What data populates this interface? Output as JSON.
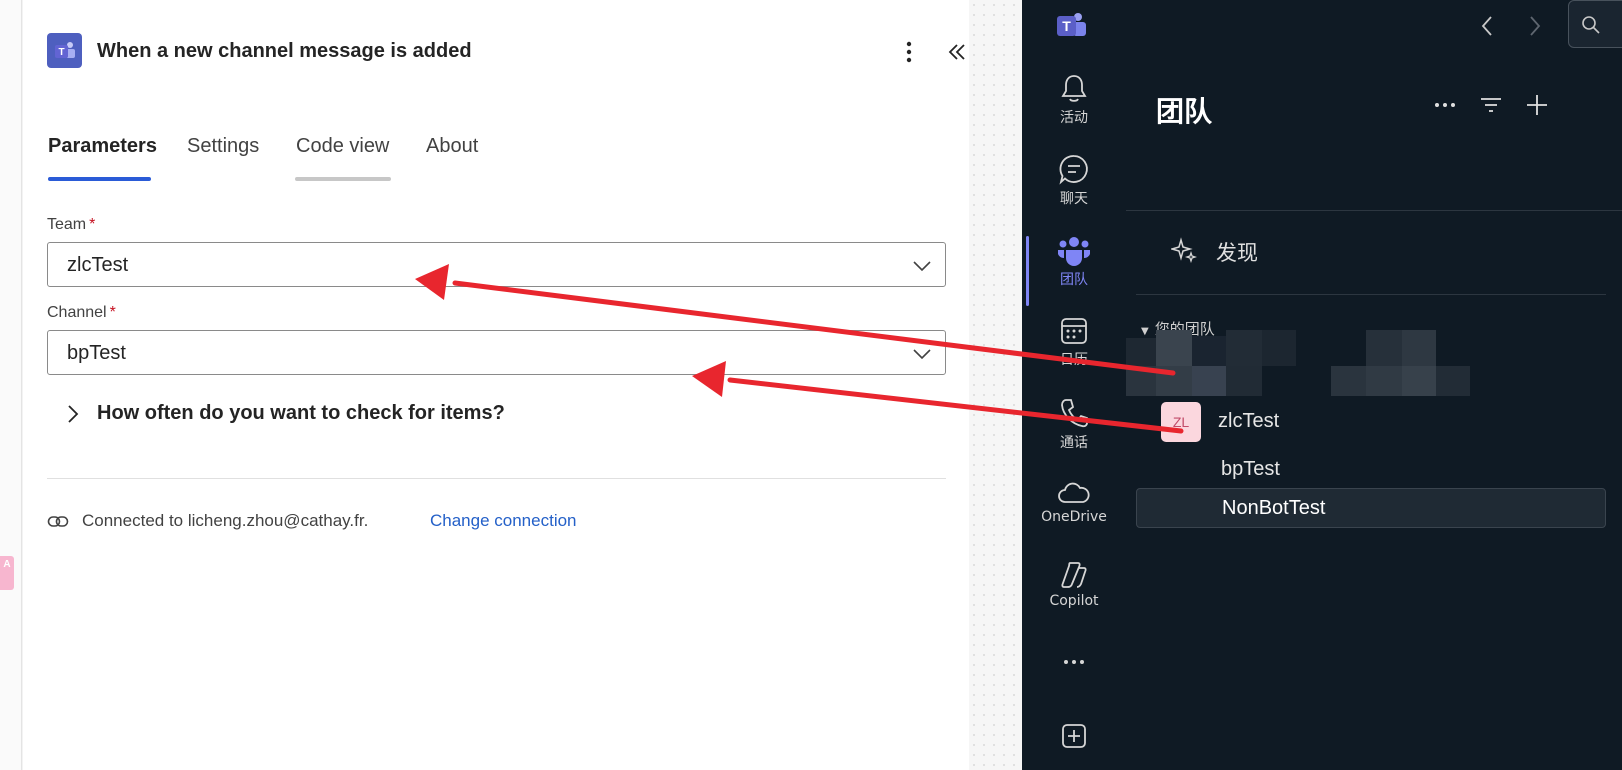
{
  "designer": {
    "side_tag": "A",
    "panel": {
      "title": "When a new channel message is added",
      "tabs": [
        "Parameters",
        "Settings",
        "Code view",
        "About"
      ],
      "team": {
        "label": "Team",
        "required_mark": "*",
        "value": "zlcTest"
      },
      "channel": {
        "label": "Channel",
        "required_mark": "*",
        "value": "bpTest"
      },
      "expander_label": "How often do you want to check for items?",
      "connection_text": "Connected to licheng.zhou@cathay.fr.",
      "change_connection": "Change connection"
    }
  },
  "teams": {
    "rail": [
      {
        "icon": "bell-icon",
        "label": "活动"
      },
      {
        "icon": "chat-icon",
        "label": "聊天"
      },
      {
        "icon": "teams-icon",
        "label": "团队"
      },
      {
        "icon": "calendar-icon",
        "label": "日历"
      },
      {
        "icon": "phone-icon",
        "label": "通话"
      },
      {
        "icon": "cloud-icon",
        "label": "OneDrive"
      },
      {
        "icon": "copilot-icon",
        "label": "Copilot"
      }
    ],
    "list_title": "团队",
    "discover": "发现",
    "section": "您的团队",
    "team": {
      "avatar": "ZL",
      "name": "zlcTest"
    },
    "channels": [
      "bpTest",
      "NonBotTest"
    ]
  },
  "colors": {
    "accent": "#2460c8",
    "arrow": "#e8262e",
    "teams_purple": "#7f85f5",
    "dark_bg": "#0f1a24"
  }
}
